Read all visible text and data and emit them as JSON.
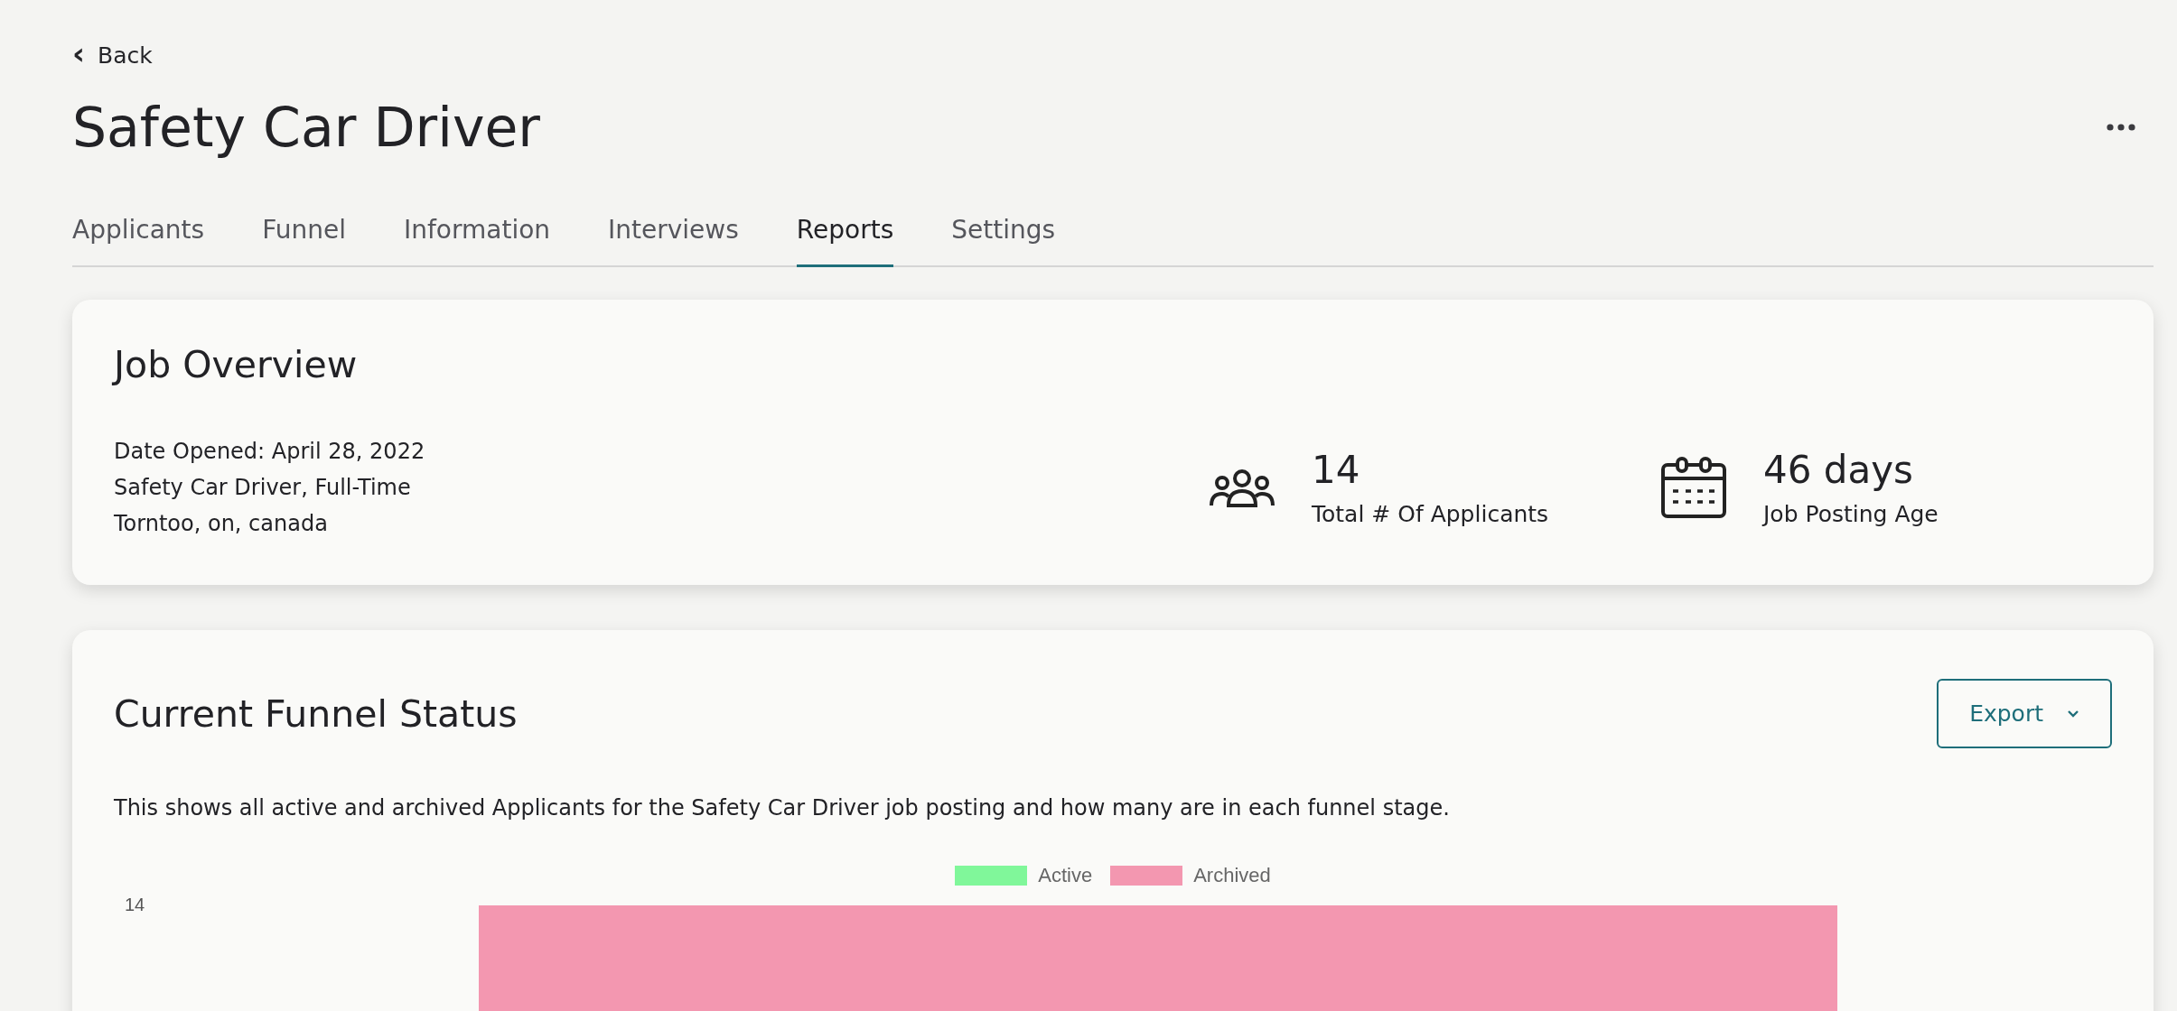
{
  "back": {
    "icon": "‹",
    "label": "Back"
  },
  "page_title": "Safety Car Driver",
  "tabs": [
    {
      "label": "Applicants",
      "selected": false
    },
    {
      "label": "Funnel",
      "selected": false
    },
    {
      "label": "Information",
      "selected": false
    },
    {
      "label": "Interviews",
      "selected": false
    },
    {
      "label": "Reports",
      "selected": true
    },
    {
      "label": "Settings",
      "selected": false
    }
  ],
  "job_overview": {
    "title": "Job Overview",
    "details": [
      "Date Opened: April 28, 2022",
      "Safety Car Driver, Full-Time",
      "Torntoo, on, canada"
    ],
    "stats": [
      {
        "kind": "people",
        "value": "14",
        "label": "Total # Of Applicants"
      },
      {
        "kind": "calendar",
        "value": "46 days",
        "label": "Job Posting Age"
      }
    ]
  },
  "funnel_status": {
    "title": "Current Funnel Status",
    "export_button": "Export",
    "description": "This shows all active and archived Applicants for the Safety Car Driver job posting and how many are in each funnel stage.",
    "chart": {
      "legend": [
        {
          "label": "Active",
          "color": "#80f79a"
        },
        {
          "label": "Archived",
          "color": "#f397b0"
        }
      ],
      "y_tick": "14"
    }
  }
}
